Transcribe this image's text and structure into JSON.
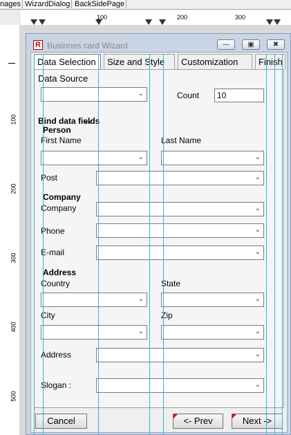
{
  "doc_tabs": [
    "nages",
    "WizardDialog",
    "BackSidePage"
  ],
  "ruler": {
    "h_labels": [
      "100",
      "200",
      "300"
    ],
    "v_labels": [
      "100",
      "200",
      "300",
      "400",
      "500"
    ]
  },
  "dialog": {
    "title": "Businnes card Wizard",
    "logo": "R",
    "window_buttons": [
      "minimize-icon",
      "maximize-icon",
      "close-icon"
    ],
    "tabs": [
      "Data Selection",
      "Size and Style",
      "Customization",
      "Finish"
    ],
    "data_source_label": "Data Source",
    "count_label": "Count",
    "count_value": "10",
    "bind_label": "Bind data fields",
    "person_group": "Person",
    "first_name_label": "First Name",
    "last_name_label": "Last Name",
    "post_label": "Post",
    "company_group": "Company",
    "company_label": "Company",
    "phone_label": "Phone",
    "email_label": "E-mail",
    "address_group": "Address",
    "country_label": "Country",
    "state_label": "State",
    "city_label": "City",
    "zip_label": "Zip",
    "address_label": "Address",
    "slogan_label": "Slogan :",
    "cancel_button": "Cancel",
    "prev_button": "<- Prev",
    "next_button": "Next ->"
  },
  "colors": {
    "guide_line": "#27b6d9",
    "title_text": "#888888",
    "flag": "#e00000"
  }
}
